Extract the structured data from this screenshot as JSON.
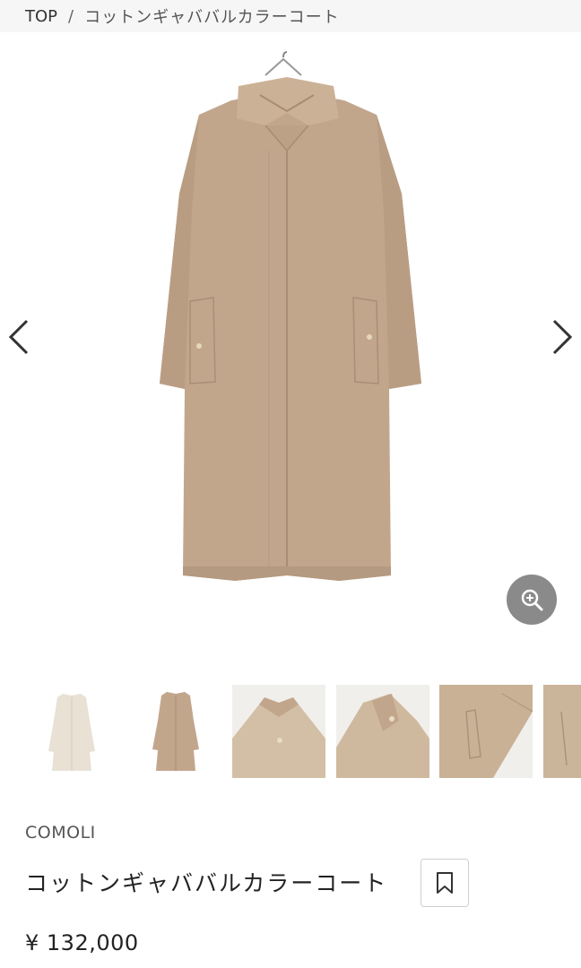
{
  "breadcrumb": {
    "home": "TOP",
    "separator": "/",
    "current": "コットンギャババルカラーコート"
  },
  "product": {
    "brand": "COMOLI",
    "name": "コットンギャババルカラーコート",
    "price": "¥ 132,000"
  },
  "gallery": {
    "thumbnails": [
      "coat-ivory",
      "coat-beige",
      "collar-detail",
      "collar-up-detail",
      "pocket-detail",
      "side-detail"
    ]
  },
  "icons": {
    "prev": "chevron-left-icon",
    "next": "chevron-right-icon",
    "zoom": "zoom-in-icon",
    "bookmark": "bookmark-icon"
  },
  "colors": {
    "coat": "#c2a68c",
    "coat_ivory": "#e8e1d4",
    "zoom_bg": "#8a8a8a"
  }
}
